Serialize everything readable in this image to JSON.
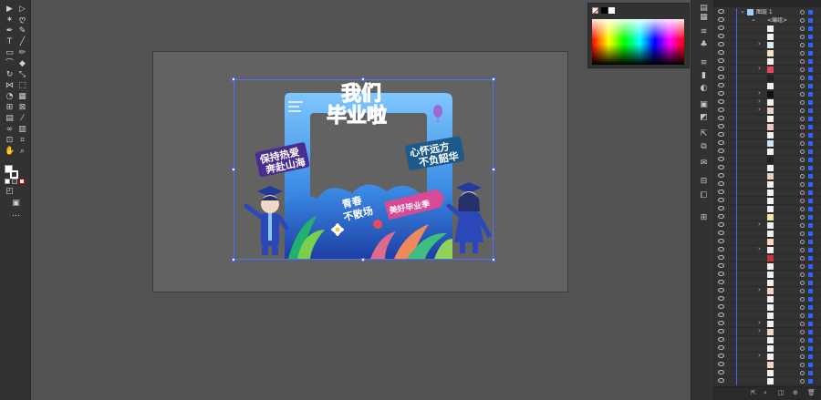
{
  "artwork": {
    "title_top": "我们",
    "title_bottom": "毕业啦",
    "slogan_left_line1": "保持热爱",
    "slogan_left_line2": "奔赴山海",
    "slogan_right_line1": "心怀远方",
    "slogan_right_line2": "不负韶华",
    "badge_youth_line1": "青春",
    "badge_youth_line2": "不散场",
    "badge_season": "美好毕业季"
  },
  "layers_panel": {
    "top_layer_name": "图层 1",
    "group_name": "<编组>"
  },
  "colors": {
    "selection": "#4a72ff",
    "panel_bg": "#323232",
    "workspace_bg": "#535353",
    "artboard_bg": "#626262"
  }
}
